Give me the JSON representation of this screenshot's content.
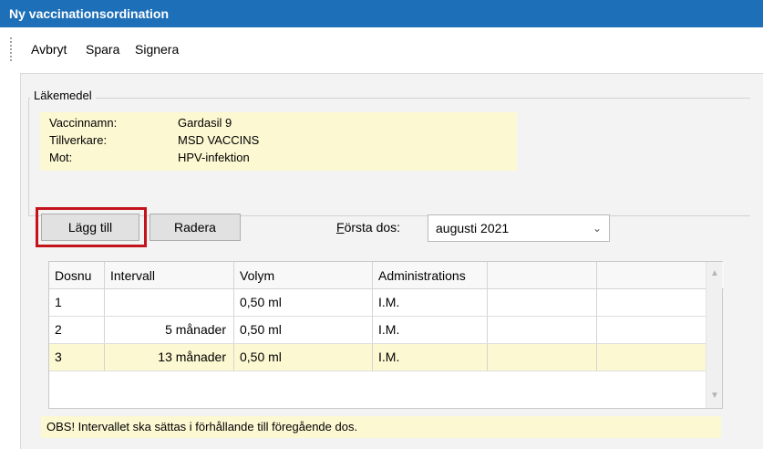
{
  "window": {
    "title": "Ny vaccinationsordination"
  },
  "menu": {
    "items": [
      {
        "label": "Avbryt"
      },
      {
        "label": "Spara"
      },
      {
        "label": "Signera"
      }
    ]
  },
  "medicine": {
    "legend": "Läkemedel",
    "rows": [
      {
        "key": "Vaccinnamn:",
        "value": "Gardasil 9"
      },
      {
        "key": "Tillverkare:",
        "value": "MSD VACCINS"
      },
      {
        "key": "Mot:",
        "value": "HPV-infektion"
      }
    ]
  },
  "buttons": {
    "add": "Lägg till",
    "delete": "Radera"
  },
  "first_dose": {
    "label_prefix": "F",
    "label_rest": "örsta dos:",
    "value": "augusti 2021"
  },
  "table": {
    "columns": [
      "Dosnu",
      "Intervall",
      "Volym",
      "Administrations",
      "",
      ""
    ],
    "rows": [
      {
        "dose": "1",
        "interval": "",
        "volume": "0,50 ml",
        "admin": "I.M.",
        "selected": false
      },
      {
        "dose": "2",
        "interval": "5  månader",
        "volume": "0,50 ml",
        "admin": "I.M.",
        "selected": false
      },
      {
        "dose": "3",
        "interval": "13  månader",
        "volume": "0,50 ml",
        "admin": "I.M.",
        "selected": true
      }
    ]
  },
  "note": "OBS! Intervallet ska sättas i förhållande till föregående dos.",
  "colors": {
    "titlebar": "#1d6fb8",
    "highlight": "#c3141c",
    "info_bg": "#fcf8d2"
  },
  "icons": {
    "dropdown": "chevron-down-icon",
    "scroll_up": "scroll-up-arrow-icon",
    "scroll_down": "scroll-down-arrow-icon"
  }
}
